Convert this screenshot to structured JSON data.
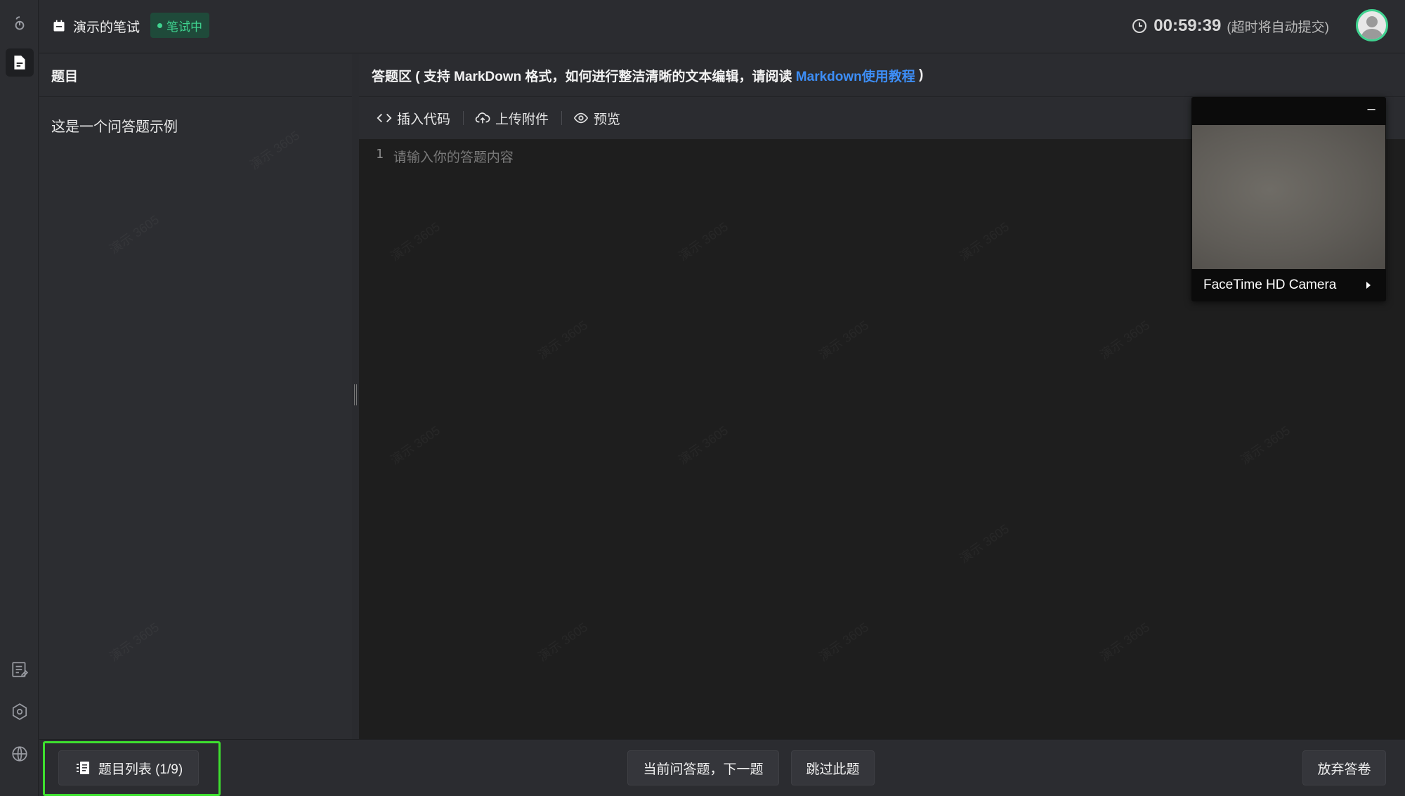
{
  "header": {
    "exam_title": "演示的笔试",
    "status_badge": "笔试中",
    "timer_value": "00:59:39",
    "timer_note": "(超时将自动提交)"
  },
  "question_panel": {
    "header": "题目",
    "question_text": "这是一个问答题示例"
  },
  "answer_panel": {
    "header_prefix": "答题区 ( 支持 MarkDown 格式，如何进行整洁清晰的文本编辑，请阅读 ",
    "header_link": "Markdown使用教程",
    "header_suffix": " )",
    "toolbar": {
      "insert_code": "插入代码",
      "upload_attachment": "上传附件",
      "preview": "预览"
    },
    "editor": {
      "line_number": "1",
      "placeholder": "请输入你的答题内容"
    }
  },
  "camera": {
    "minimize_label": "–",
    "device_name": "FaceTime HD Camera"
  },
  "footer": {
    "question_list_button": "题目列表 (1/9)",
    "next_button": "当前问答题，下一题",
    "skip_button": "跳过此题",
    "abandon_button": "放弃答卷"
  },
  "watermark": "演示 3605",
  "colors": {
    "accent_green": "#3fd28f",
    "link_blue": "#3d8ef7",
    "highlight_green": "#3ee02f"
  }
}
